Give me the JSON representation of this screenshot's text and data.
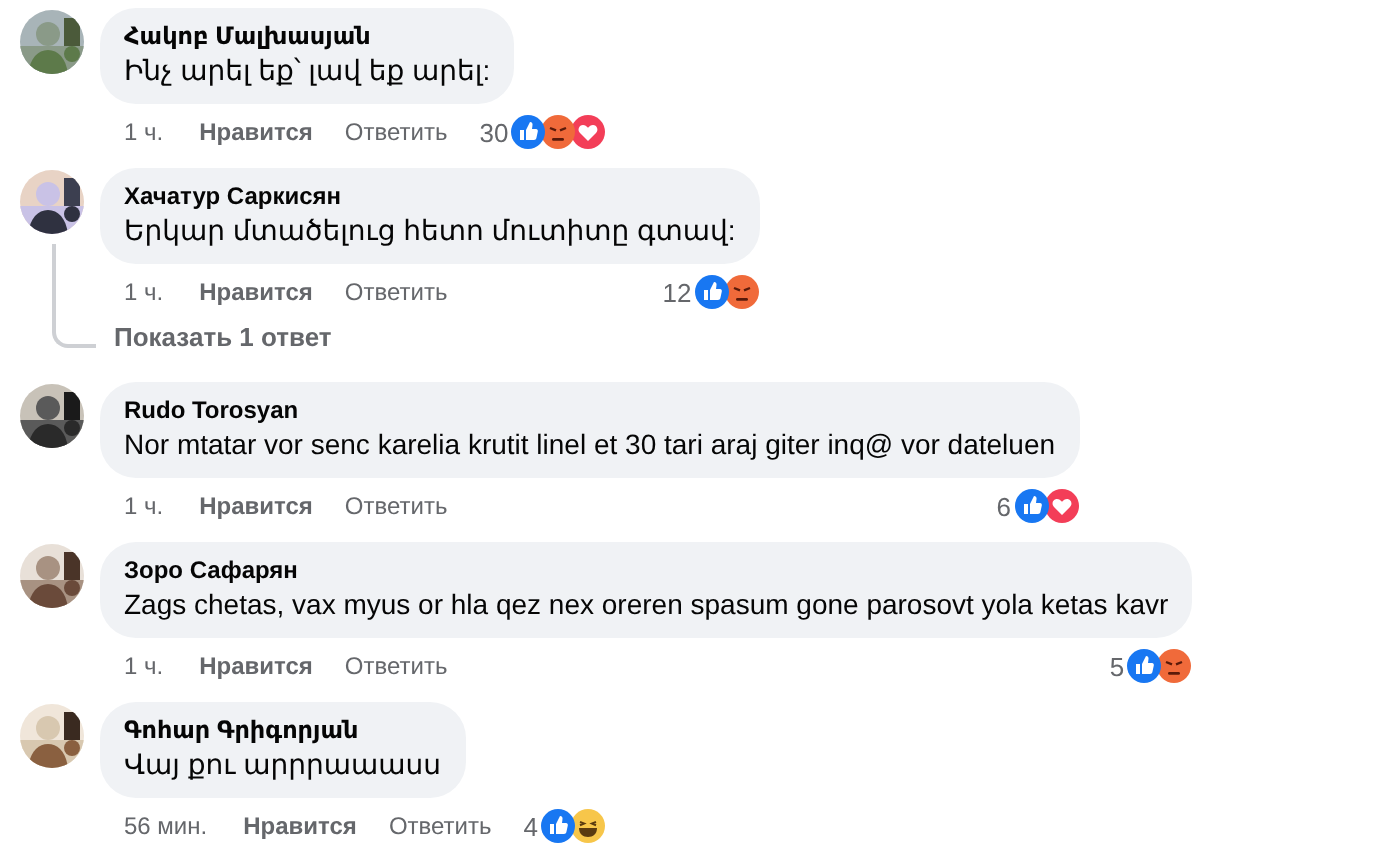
{
  "comments": [
    {
      "author": "Հակոբ Մալխասյան",
      "text": "Ինչ արել եք՝ լավ եք արել:",
      "time": "1 ч.",
      "like": "Нравится",
      "reply": "Ответить",
      "count": "30",
      "reactions": [
        {
          "kind": "like"
        },
        {
          "kind": "angry"
        },
        {
          "kind": "love"
        }
      ]
    },
    {
      "author": "Хачатур Саркисян",
      "text": "Երկար մտածելուց հետո մուտիտը գտավ:",
      "time": "1 ч.",
      "like": "Нравится",
      "reply": "Ответить",
      "count": "12",
      "reactions": [
        {
          "kind": "like"
        },
        {
          "kind": "angry"
        }
      ],
      "show_replies": "Показать 1 ответ"
    },
    {
      "author": "Rudo Torosyan",
      "text": "Nor mtatar vor senc karelia krutit linel et 30 tari araj giter inq@ vor dateluen",
      "time": "1 ч.",
      "like": "Нравится",
      "reply": "Ответить",
      "count": "6",
      "reactions": [
        {
          "kind": "like"
        },
        {
          "kind": "love"
        }
      ]
    },
    {
      "author": "Зоро Сафарян",
      "text": "Zags chetas, vax myus or hla qez nex oreren spasum gone parosovt yola ketas kavr",
      "time": "1 ч.",
      "like": "Нравится",
      "reply": "Ответить",
      "count": "5",
      "reactions": [
        {
          "kind": "like"
        },
        {
          "kind": "angry"
        }
      ]
    },
    {
      "author": "Գոհար Գրիգորյան",
      "text": "Վայ քու արրրաաասս",
      "time": "56 мин.",
      "like": "Нравится",
      "reply": "Ответить",
      "count": "4",
      "reactions": [
        {
          "kind": "like"
        },
        {
          "kind": "haha"
        }
      ]
    }
  ]
}
